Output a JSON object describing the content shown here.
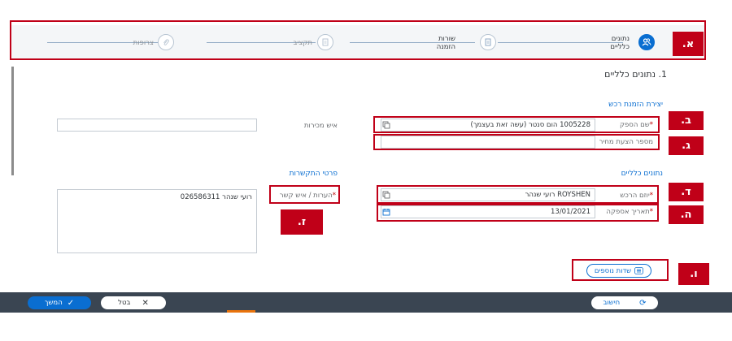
{
  "wizard": {
    "steps": [
      {
        "label_line1": "נתונים",
        "label_line2": "כלליים",
        "icon": "people-icon",
        "active": true
      },
      {
        "label_line1": "שורות",
        "label_line2": "הזמנה",
        "icon": "document-icon",
        "active": false
      },
      {
        "label_line1": "תקציב",
        "label_line2": "",
        "icon": "document-icon",
        "active": false
      },
      {
        "label_line1": "צרופות",
        "label_line2": "",
        "icon": "attachment-icon",
        "active": false
      }
    ]
  },
  "annotations": {
    "a": "א.",
    "b": "ב.",
    "g": "ג.",
    "d": "ד.",
    "h": "ה.",
    "v": "ו.",
    "z": "ז."
  },
  "page": {
    "section_heading": "1. נתונים כלליים",
    "purchase": {
      "title": "יצירת הזמנת רכש",
      "supplier_label": "שם הספק",
      "supplier_value": "1005228 הום סנטר (עשה זאת בעצמך)",
      "quote_label": "מספר הצעת מחיר",
      "quote_value": "",
      "sales_person_label": "איש מכירות",
      "sales_person_value": ""
    },
    "general": {
      "title": "נתונים כלליים",
      "buyer_label": "יוזם הרכש",
      "buyer_value": "ROYSHEN רועי שנהר",
      "delivery_label": "תאריך אספקה",
      "delivery_value": "13/01/2021"
    },
    "contact": {
      "title": "פרטי התקשרות",
      "notes_label": "הערות / איש קשר",
      "notes_value": "רועי שנהר 026586311"
    },
    "additional_fields_button": "שדות נוספים"
  },
  "footer": {
    "continue": "המשך",
    "cancel": "בטל",
    "calculate": "חישוב"
  },
  "colors": {
    "accent": "#0a6ed1",
    "annotation": "#c00018",
    "footer_bg": "#3a4552"
  }
}
